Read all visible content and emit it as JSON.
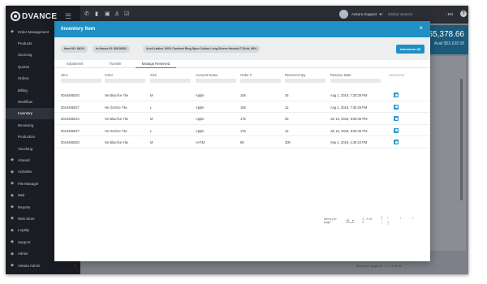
{
  "app": {
    "logo": "DVANCE",
    "sidebar": [
      {
        "label": "Order Management",
        "icon": "grid-icon",
        "sub": false,
        "active": false,
        "caret": true
      },
      {
        "label": "Products",
        "sub": true,
        "active": false
      },
      {
        "label": "Sourcing",
        "sub": true,
        "active": false
      },
      {
        "label": "Quotes",
        "sub": true,
        "active": false
      },
      {
        "label": "Orders",
        "sub": true,
        "active": false
      },
      {
        "label": "Billing",
        "sub": true,
        "active": false
      },
      {
        "label": "Workflow",
        "sub": true,
        "active": false
      },
      {
        "label": "Inventory",
        "sub": true,
        "active": true
      },
      {
        "label": "Receiving",
        "sub": true,
        "active": false
      },
      {
        "label": "Production",
        "sub": true,
        "active": false
      },
      {
        "label": "Vouching",
        "sub": true,
        "active": false
      },
      {
        "label": "Artwork",
        "icon": "brush-icon",
        "sub": false,
        "active": false
      },
      {
        "label": "Activities",
        "icon": "clock-icon",
        "sub": false,
        "active": false
      },
      {
        "label": "File Manager",
        "icon": "folder-icon",
        "sub": false,
        "active": false
      },
      {
        "label": "Mail",
        "icon": "mail-icon",
        "sub": false,
        "active": false
      },
      {
        "label": "Reports",
        "icon": "chart-icon",
        "sub": false,
        "active": false
      },
      {
        "label": "Web Store",
        "icon": "store-icon",
        "sub": false,
        "active": false
      },
      {
        "label": "Loyalty",
        "icon": "gift-icon",
        "sub": false,
        "active": false
      },
      {
        "label": "Support",
        "icon": "support-icon",
        "sub": false,
        "active": false
      },
      {
        "label": "Admin",
        "icon": "gear-icon",
        "sub": false,
        "active": false
      },
      {
        "label": "Ankara Admin",
        "icon": "user-icon",
        "sub": false,
        "active": false,
        "caret": true
      }
    ],
    "topbar": {
      "user": "Ankara Support",
      "search_placeholder": "Global Search",
      "lang": "EN",
      "help": "?"
    },
    "revenue": {
      "amount": "$55,378.66",
      "sub": "Avail $53,628.38"
    },
    "bg_pager": "Items per page  10  ·  1 - 10 of 22"
  },
  "modal": {
    "title": "Inventory Item",
    "close": "×",
    "chips": {
      "item_no": "Item NO: 881%",
      "in_house": "In-House ID: 50618362",
      "description": "Anvil Ladies 100% Combed Ring Spun Cotton Long Sleeve Hooded T-Shirt, 98%"
    },
    "unreserve_label": "Unreserve All",
    "tabs": [
      "Adjustment",
      "Transfer",
      "Manage Reserved"
    ],
    "columns": [
      "SKU",
      "Color",
      "Size",
      "Account Name",
      "Order #",
      "Reserved Qty",
      "Reserve Date",
      "Unreserve"
    ],
    "rows": [
      {
        "sku": "0044495020",
        "color": "He Blue/Ice Ylw",
        "size": "M",
        "account": "Apple",
        "order": "165",
        "qty": "25",
        "date": "Aug 1, 2019, 7:30:29 PM"
      },
      {
        "sku": "0044495027",
        "color": "He Grn/Ice Ylw",
        "size": "L",
        "account": "Apple",
        "order": "165",
        "qty": "12",
        "date": "Aug 1, 2019, 7:30:29 PM"
      },
      {
        "sku": "0044495024",
        "color": "He Blue/Ice Ylw",
        "size": "M",
        "account": "Apple",
        "order": "175",
        "qty": "25",
        "date": "Jul 16, 2019, 8:59:45 PM"
      },
      {
        "sku": "0044495027",
        "color": "He Grn/Ice Ylw",
        "size": "L",
        "account": "Apple",
        "order": "175",
        "qty": "12",
        "date": "Jul 16, 2019, 8:59:46 PM"
      },
      {
        "sku": "0044495020",
        "color": "He Blue/Ice Ylw",
        "size": "M",
        "account": "AATM",
        "order": "89",
        "qty": "300",
        "date": "Sep 4, 2019, 4:49:23 PM"
      }
    ],
    "pager": {
      "label": "Items per page:",
      "per_page": "10",
      "range": "1 - 5 of 5",
      "nav": "|‹ ‹ › ›|"
    }
  },
  "colors": {
    "accent": "#1f8fc4",
    "sidebar": "#1b1d24",
    "revenue": "#1a5a7b"
  }
}
